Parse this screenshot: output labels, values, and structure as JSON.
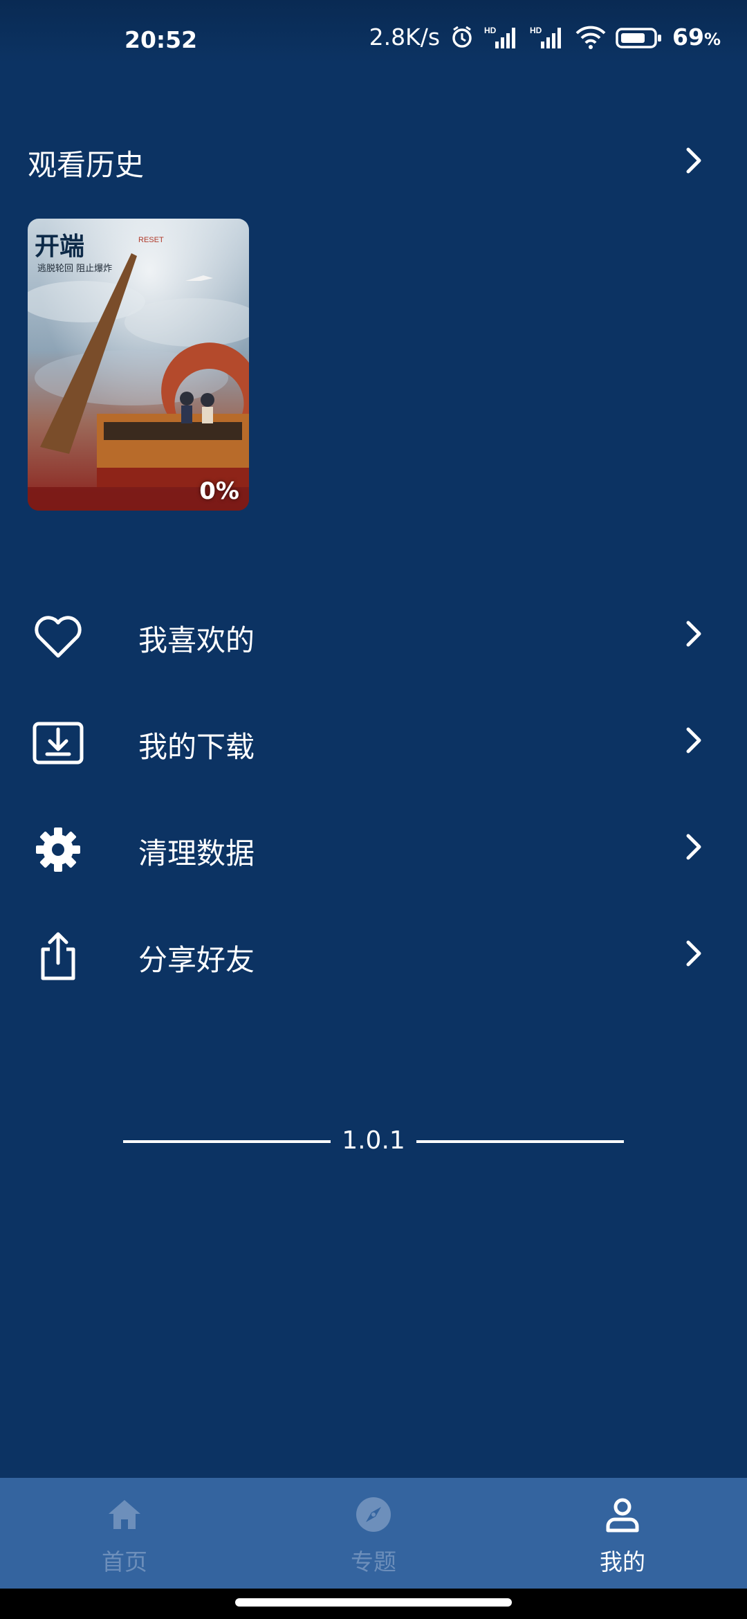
{
  "status_bar": {
    "time": "20:52",
    "network_speed": "2.8K/s",
    "battery_percent": "69",
    "battery_suffix": "%",
    "icons": [
      "alarm-icon",
      "signal-hd-icon",
      "signal-hd-icon",
      "wifi-icon",
      "battery-icon"
    ]
  },
  "history": {
    "title": "观看历史",
    "items": [
      {
        "poster_title": "开端",
        "poster_subtitle": "RESET",
        "poster_tagline": "逃脱轮回  阻止爆炸",
        "progress": "0%"
      }
    ]
  },
  "menu": {
    "items": [
      {
        "label": "我喜欢的",
        "icon": "heart-icon"
      },
      {
        "label": "我的下载",
        "icon": "download-icon"
      },
      {
        "label": "清理数据",
        "icon": "gear-icon"
      },
      {
        "label": "分享好友",
        "icon": "share-icon"
      }
    ]
  },
  "version": "1.0.1",
  "bottom_nav": {
    "tabs": [
      {
        "label": "首页",
        "icon": "home-icon",
        "active": false
      },
      {
        "label": "专题",
        "icon": "compass-icon",
        "active": false
      },
      {
        "label": "我的",
        "icon": "user-icon",
        "active": true
      }
    ]
  },
  "colors": {
    "background": "#0c3363",
    "nav_background": "#34649f",
    "nav_inactive": "#6d8fbb",
    "nav_active": "#ffffff"
  }
}
